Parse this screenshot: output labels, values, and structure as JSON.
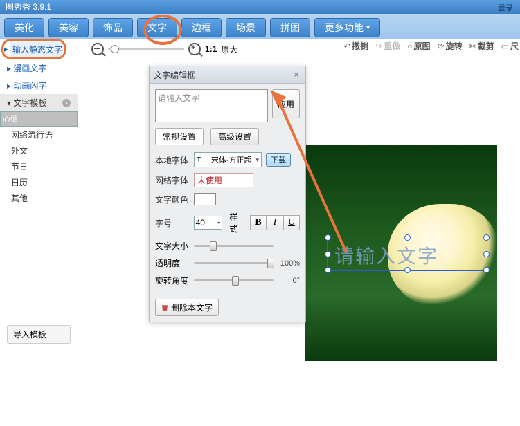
{
  "app": {
    "title": "图秀秀 3.9.1",
    "login": "登录"
  },
  "tabs": [
    "美化",
    "美容",
    "饰品",
    "文字",
    "边框",
    "场景",
    "拼图",
    "更多功能"
  ],
  "subbar": {
    "input_static": "输入静态文字",
    "comic": "漫画文字",
    "anim": "动画闪字",
    "ratio": "1:1",
    "origsize": "原大"
  },
  "ops": {
    "undo": "撤销",
    "redo": "重做",
    "orig": "原图",
    "rotate": "旋转",
    "crop": "裁剪",
    "ruler": "尺"
  },
  "sidebar": {
    "header": "文字模板",
    "items": [
      "心情",
      "网络流行语",
      "外文",
      "节日",
      "日历",
      "其他"
    ],
    "import": "导入模板"
  },
  "dialog": {
    "title": "文字编辑框",
    "placeholder": "请输入文字",
    "apply": "应用",
    "tab_basic": "常规设置",
    "tab_adv": "高级设置",
    "local_font_lbl": "本地字体",
    "local_font_val": "宋体-方正超",
    "download": "下载",
    "net_font_lbl": "网络字体",
    "net_font_val": "未使用",
    "color_lbl": "文字颜色",
    "size_lbl": "字号",
    "size_val": "40",
    "style_lbl": "样式",
    "textsize_lbl": "文字大小",
    "opacity_lbl": "透明度",
    "opacity_val": "100%",
    "angle_lbl": "旋转角度",
    "angle_val": "0°",
    "delete": "删除本文字"
  },
  "canvas": {
    "placeholder": "请输入文字"
  }
}
